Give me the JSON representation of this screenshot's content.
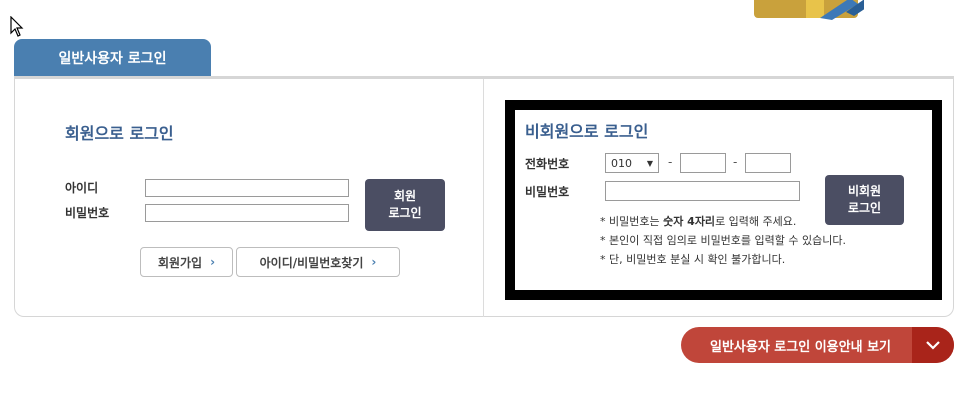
{
  "tabs": [
    {
      "label": "일반사용자 로그인"
    }
  ],
  "member": {
    "title": "회원으로 로그인",
    "id_label": "아이디",
    "pw_label": "비밀번호",
    "id_value": "",
    "pw_value": "",
    "login_button": [
      "회원",
      "로그인"
    ],
    "signup_button": "회원가입",
    "find_button": "아이디/비밀번호찾기"
  },
  "guest": {
    "title": "비회원으로 로그인",
    "phone_label": "전화번호",
    "pw_label": "비밀번호",
    "phone_prefix": "010",
    "phone_sep": "-",
    "phone_mid": "",
    "phone_last": "",
    "pw_value": "",
    "login_button": [
      "비회원",
      "로그인"
    ],
    "notes": [
      {
        "pre": "* 비밀번호는 ",
        "bold": "숫자 4자리",
        "post": "로 입력해 주세요."
      },
      {
        "pre": "* 본인이 직접 임의로 비밀번호를 입력할 수 있습니다.",
        "bold": "",
        "post": ""
      },
      {
        "pre": "* 단, 비밀번호 분실 시 확인 불가합니다.",
        "bold": "",
        "post": ""
      }
    ]
  },
  "guide_button": "일반사용자 로그인 이용안내 보기",
  "colors": {
    "accent": "#4a7fb0",
    "dark_button": "#4b4e63",
    "guide": "#c0463a"
  },
  "icons": [
    "cursor-icon",
    "chevron-right-icon",
    "chevron-down-icon"
  ]
}
